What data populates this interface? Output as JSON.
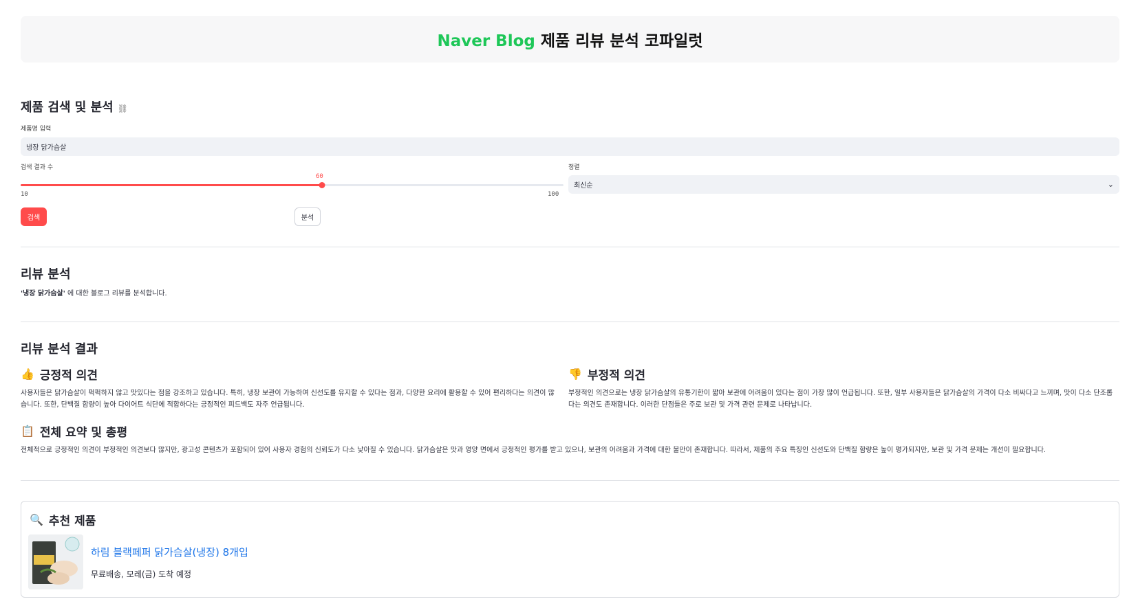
{
  "header": {
    "brand": "Naver Blog",
    "title_rest": " 제품 리뷰 분석 코파일럿"
  },
  "search_section": {
    "heading": "제품 검색 및 분석",
    "link_icon": "link-icon",
    "product_label": "제품명 입력",
    "product_value": "냉장 닭가슴살",
    "count_label": "검색 결과 수",
    "count_value": 60,
    "count_value_text": "60",
    "count_min": "10",
    "count_max": "100",
    "sort_label": "정렬",
    "sort_value": "최신순",
    "search_button": "검색",
    "analyze_button": "분석",
    "accent_color": "#ff4b4b"
  },
  "review_analysis": {
    "heading": "리뷰 분석",
    "desc_bold": "'냉장 닭가슴살'",
    "desc_rest": " 에 대한 블로그 리뷰를 분석합니다."
  },
  "results": {
    "heading": "리뷰 분석 결과",
    "positive": {
      "icon": "thumbs-up-icon",
      "emoji": "👍",
      "title": "긍정적 의견",
      "text": "사용자들은 닭가슴살이 퍽퍽하지 않고 맛있다는 점을 강조하고 있습니다. 특히, 냉장 보관이 가능하여 신선도를 유지할 수 있다는 점과, 다양한 요리에 활용할 수 있어 편리하다는 의견이 많습니다. 또한, 단백질 함량이 높아 다이어트 식단에 적합하다는 긍정적인 피드백도 자주 언급됩니다."
    },
    "negative": {
      "icon": "thumbs-down-icon",
      "emoji": "👎",
      "title": "부정적 의견",
      "text": "부정적인 의견으로는 냉장 닭가슴살의 유통기한이 짧아 보관에 어려움이 있다는 점이 가장 많이 언급됩니다. 또한, 일부 사용자들은 닭가슴살의 가격이 다소 비싸다고 느끼며, 맛이 다소 단조롭다는 의견도 존재합니다. 이러한 단점들은 주로 보관 및 가격 관련 문제로 나타납니다."
    },
    "summary": {
      "icon": "clipboard-icon",
      "emoji": "📋",
      "title": "전체 요약 및 총평",
      "text": "전체적으로 긍정적인 의견이 부정적인 의견보다 많지만, 광고성 콘텐츠가 포함되어 있어 사용자 경험의 신뢰도가 다소 낮아질 수 있습니다. 닭가슴살은 맛과 영양 면에서 긍정적인 평가를 받고 있으나, 보관의 어려움과 가격에 대한 불만이 존재합니다. 따라서, 제품의 주요 특징인 신선도와 단백질 함량은 높이 평가되지만, 보관 및 가격 문제는 개선이 필요합니다."
    }
  },
  "recommendation": {
    "icon": "magnifier-icon",
    "emoji": "🔍",
    "title": "추천 제품",
    "product_name": "하림 블랙페퍼 닭가슴살(냉장) 8개입",
    "product_info": "무료배송, 모레(금) 도착 예정"
  }
}
